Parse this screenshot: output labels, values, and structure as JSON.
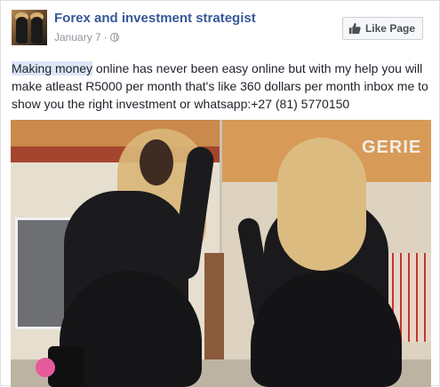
{
  "post": {
    "page_name": "Forex and investment strategist",
    "date": "January 7",
    "dot": "·",
    "like_page_label": "Like Page",
    "text_highlight": "Making money",
    "text_rest": " online has never been easy online but with my help you will make atleast R5000 per month that's like 360 dollars per month inbox me to show you the right investment or whatsapp:+27 (81) 5770150"
  },
  "photo": {
    "sign_text": "GERIE"
  },
  "colors": {
    "link": "#365899",
    "meta": "#90949c",
    "text": "#1d2129",
    "button_bg": "#f6f7f9",
    "highlight": "#dce6f8"
  },
  "icons": {
    "audience": "globe-icon",
    "like": "thumbs-up-icon"
  }
}
